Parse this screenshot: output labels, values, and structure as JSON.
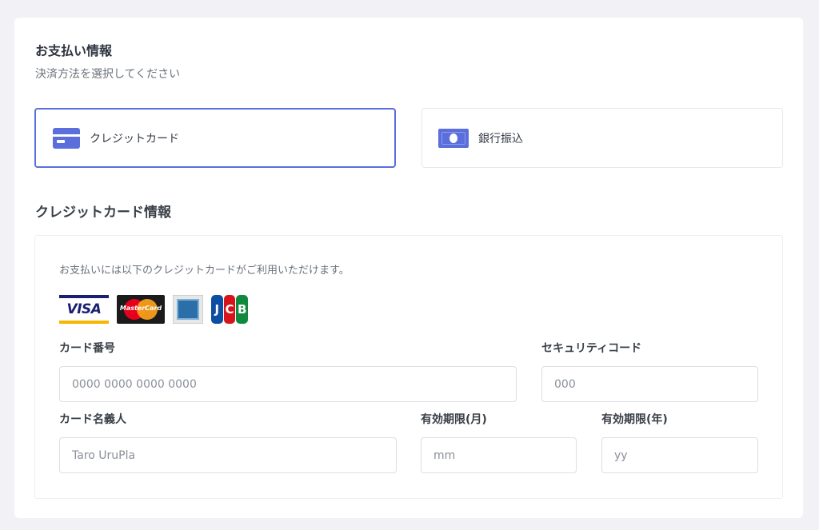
{
  "payment": {
    "title": "お支払い情報",
    "subtitle": "決済方法を選択してください",
    "methods": [
      {
        "label": "クレジットカード",
        "icon": "credit-card-icon",
        "selected": true
      },
      {
        "label": "銀行振込",
        "icon": "cash-icon",
        "selected": false
      }
    ]
  },
  "card_section": {
    "title": "クレジットカード情報",
    "notice": "お支払いには以下のクレジットカードがご利用いただけます。",
    "brands": {
      "visa": "VISA",
      "mastercard": "MasterCard",
      "jcb": [
        "J",
        "C",
        "B"
      ]
    },
    "fields": {
      "number": {
        "label": "カード番号",
        "placeholder": "0000 0000 0000 0000"
      },
      "cvc": {
        "label": "セキュリティコード",
        "placeholder": "000"
      },
      "holder": {
        "label": "カード名義人",
        "placeholder": "Taro UruPla"
      },
      "month": {
        "label": "有効期限(月)",
        "placeholder": "mm"
      },
      "year": {
        "label": "有効期限(年)",
        "placeholder": "yy"
      }
    }
  },
  "colors": {
    "accent": "#5b6fdc",
    "background": "#f1f1f6"
  }
}
